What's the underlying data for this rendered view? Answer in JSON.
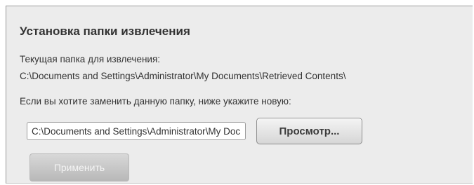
{
  "panel": {
    "title": "Установка папки извлечения",
    "current_folder_label": "Текущая папка для извлечения:",
    "current_folder_path": "C:\\Documents and Settings\\Administrator\\My Documents\\Retrieved Contents\\",
    "instruction": "Если вы хотите заменить данную папку, ниже укажите новую:",
    "folder_input_value": "C:\\Documents and Settings\\Administrator\\My Documents\\Retrieved Contents\\",
    "browse_label": "Просмотр...",
    "apply_label": "Применить",
    "apply_enabled": false
  }
}
